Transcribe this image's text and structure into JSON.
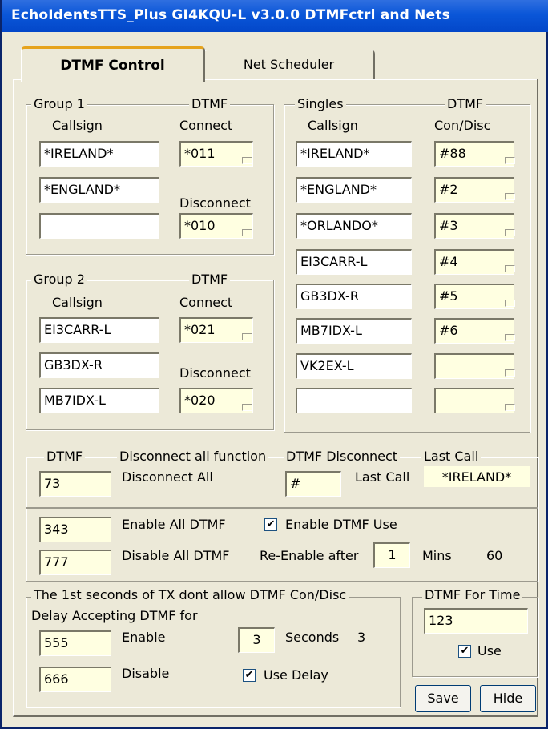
{
  "window": {
    "title": "EchoIdentsTTS_Plus   GI4KQU-L   v3.0.0   DTMFctrl and Nets"
  },
  "tabs": [
    {
      "label": "DTMF Control"
    },
    {
      "label": "Net Scheduler"
    }
  ],
  "group1": {
    "title": "Group 1",
    "dtmf_label": "DTMF",
    "callsign_header": "Callsign",
    "connect_label": "Connect",
    "disconnect_label": "Disconnect",
    "callsigns": [
      "*IRELAND*",
      "*ENGLAND*",
      ""
    ],
    "connect_code": "*011",
    "disconnect_code": "*010"
  },
  "group2": {
    "title": "Group 2",
    "dtmf_label": "DTMF",
    "callsign_header": "Callsign",
    "connect_label": "Connect",
    "disconnect_label": "Disconnect",
    "callsigns": [
      "EI3CARR-L",
      "GB3DX-R",
      "MB7IDX-L"
    ],
    "connect_code": "*021",
    "disconnect_code": "*020"
  },
  "singles": {
    "title": "Singles",
    "dtmf_label": "DTMF",
    "callsign_header": "Callsign",
    "code_header": "Con/Disc",
    "rows": [
      {
        "callsign": "*IRELAND*",
        "code": "#88"
      },
      {
        "callsign": "*ENGLAND*",
        "code": "#2"
      },
      {
        "callsign": "*ORLANDO*",
        "code": "#3"
      },
      {
        "callsign": "EI3CARR-L",
        "code": "#4"
      },
      {
        "callsign": "GB3DX-R",
        "code": "#5"
      },
      {
        "callsign": "MB7IDX-L",
        "code": "#6"
      },
      {
        "callsign": "VK2EX-L",
        "code": ""
      },
      {
        "callsign": "",
        "code": ""
      }
    ]
  },
  "disconnect_all": {
    "dtmf_label": "DTMF",
    "title": "Disconnect all function",
    "code": "73",
    "label": "Disconnect All"
  },
  "dtmf_disconnect": {
    "title": "DTMF Disconnect",
    "code": "#",
    "last_call_title": "Last Call",
    "last_call_label": "Last Call",
    "last_call_value": "*IRELAND*"
  },
  "enable_section": {
    "enable_code": "343",
    "enable_label": "Enable All DTMF",
    "enable_use_label": "Enable DTMF Use",
    "enable_use_checked": true,
    "disable_code": "777",
    "disable_label": "Disable All DTMF",
    "reenable_label": "Re-Enable after",
    "reenable_value": "1",
    "mins_label": "Mins",
    "mins_value": "60"
  },
  "delay_section": {
    "title": "The 1st seconds of TX dont allow DTMF Con/Disc",
    "subtitle": "Delay Accepting DTMF for",
    "enable_code": "555",
    "enable_label": "Enable",
    "seconds_value": "3",
    "seconds_label": "Seconds",
    "seconds_display": "3",
    "disable_code": "666",
    "disable_label": "Disable",
    "use_delay_label": "Use Delay",
    "use_delay_checked": true
  },
  "time_section": {
    "title": "DTMF For Time",
    "code": "123",
    "use_label": "Use",
    "use_checked": true
  },
  "buttons": {
    "save": "Save",
    "hide": "Hide"
  },
  "check_glyph": "✔"
}
